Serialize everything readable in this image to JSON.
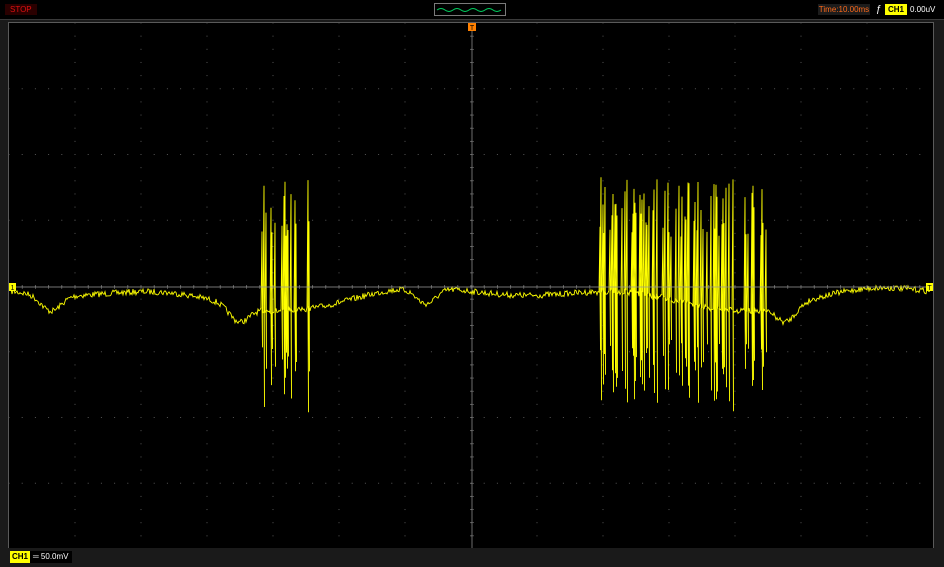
{
  "toolbar": {
    "status_label": "STOP",
    "timebase_label": "Time:10.00ms",
    "trigger_channel": "CH1",
    "trigger_level": "0.00uV"
  },
  "display": {
    "trigger_marker": "T",
    "channel_marker_left": "1",
    "channel_marker_right": "T"
  },
  "footer": {
    "channel_label": "CH1",
    "coupling_symbol": "═",
    "vertical_scale": "50.0mV"
  },
  "colors": {
    "trace": "#ffff00",
    "status": "#e01010",
    "timebase": "#ff6a1a",
    "trigger_marker": "#ff8000",
    "grid": "#404040"
  },
  "icons": {
    "trigger_edge": "rising-edge-icon",
    "overview": "waveform-overview-icon"
  }
}
